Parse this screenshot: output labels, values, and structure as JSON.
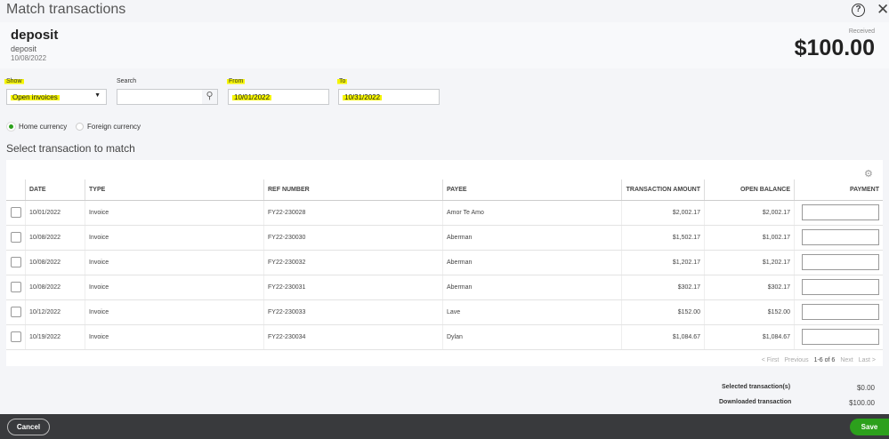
{
  "dialog": {
    "title": "Match transactions"
  },
  "deposit": {
    "name": "deposit",
    "description": "deposit",
    "date": "10/08/2022",
    "amount_label": "Received",
    "amount": "$100.00"
  },
  "filters": {
    "show_label": "Show",
    "show_value": "Open invoices",
    "search_label": "Search",
    "search_value": "",
    "from_label": "From",
    "from_value": "10/01/2022",
    "to_label": "To",
    "to_value": "10/31/2022"
  },
  "currency": {
    "home": "Home currency",
    "foreign": "Foreign currency",
    "selected": "home"
  },
  "section_title": "Select transaction to match",
  "table": {
    "headers": [
      "DATE",
      "TYPE",
      "REF NUMBER",
      "PAYEE",
      "TRANSACTION AMOUNT",
      "OPEN BALANCE",
      "PAYMENT"
    ],
    "rows": [
      [
        "10/01/2022",
        "Invoice",
        "FY22-230028",
        "Amor Te Amo",
        "$2,002.17",
        "$2,002.17"
      ],
      [
        "10/08/2022",
        "Invoice",
        "FY22-230030",
        "Aberman",
        "$1,502.17",
        "$1,002.17"
      ],
      [
        "10/08/2022",
        "Invoice",
        "FY22-230032",
        "Aberman",
        "$1,202.17",
        "$1,202.17"
      ],
      [
        "10/08/2022",
        "Invoice",
        "FY22-230031",
        "Aberman",
        "$302.17",
        "$302.17"
      ],
      [
        "10/12/2022",
        "Invoice",
        "FY22-230033",
        "Lave",
        "$152.00",
        "$152.00"
      ],
      [
        "10/19/2022",
        "Invoice",
        "FY22-230034",
        "Dylan",
        "$1,084.67",
        "$1,084.67"
      ]
    ]
  },
  "pager": {
    "first": "< First",
    "previous": "Previous",
    "range": "1-6 of 6",
    "next": "Next",
    "last": "Last >"
  },
  "summary": {
    "selected_label": "Selected transaction(s)",
    "selected_value": "$0.00",
    "downloaded_label": "Downloaded transaction",
    "downloaded_value": "$100.00"
  },
  "footer": {
    "cancel": "Cancel",
    "save": "Save"
  },
  "colors": {
    "accent": "#2ca01c",
    "footer": "#393a3d",
    "highlight": "#f5f500"
  }
}
